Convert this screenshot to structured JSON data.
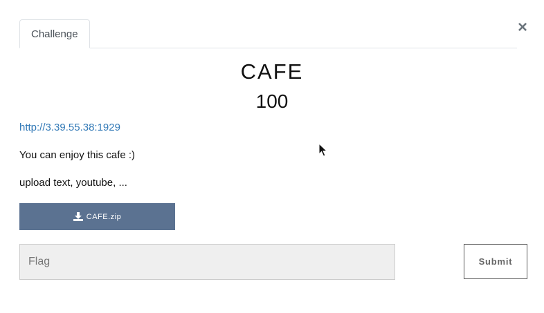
{
  "tabs": [
    {
      "label": "Challenge"
    }
  ],
  "close_label": "×",
  "challenge": {
    "name": "CAFE",
    "points": "100",
    "link": "http://3.39.55.38:1929",
    "description": [
      "You can enjoy this cafe :)",
      "upload text, youtube, ..."
    ],
    "file_label": "CAFE.zip"
  },
  "form": {
    "flag_placeholder": "Flag",
    "flag_value": "",
    "submit_label": "Submit"
  },
  "colors": {
    "download_button": "#5b7291",
    "link": "#337ab7"
  }
}
